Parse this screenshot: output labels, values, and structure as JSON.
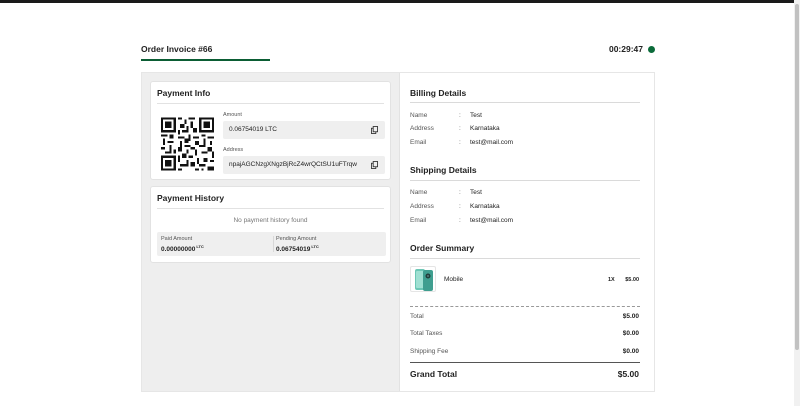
{
  "header": {
    "title": "Order Invoice #66",
    "timer": "00:29:47"
  },
  "payment_info": {
    "title": "Payment Info",
    "amount_label": "Amount",
    "amount_value": "0.06754019 LTC",
    "address_label": "Address",
    "address_value": "npajAGCNzgXNgzBjRcZ4wrQCtSU1uFTrqw"
  },
  "payment_history": {
    "title": "Payment History",
    "empty_message": "No payment history found",
    "paid_label": "Paid Amount",
    "paid_value": "0.00000000",
    "paid_unit": "LTC",
    "pending_label": "Pending Amount",
    "pending_value": "0.06754019",
    "pending_unit": "LTC"
  },
  "billing": {
    "title": "Billing Details",
    "rows": [
      {
        "key": "Name",
        "value": "Test"
      },
      {
        "key": "Address",
        "value": "Karnataka"
      },
      {
        "key": "Email",
        "value": "test@mail.com"
      }
    ]
  },
  "shipping": {
    "title": "Shipping Details",
    "rows": [
      {
        "key": "Name",
        "value": "Test"
      },
      {
        "key": "Address",
        "value": "Karnataka"
      },
      {
        "key": "Email",
        "value": "test@mail.com"
      }
    ]
  },
  "order_summary": {
    "title": "Order Summary",
    "items": [
      {
        "name": "Mobile",
        "qty": "1X",
        "price": "$5.00"
      }
    ],
    "total_label": "Total",
    "total_value": "$5.00",
    "taxes_label": "Total Taxes",
    "taxes_value": "$0.00",
    "shipping_label": "Shipping Fee",
    "shipping_value": "$0.00",
    "grand_label": "Grand Total",
    "grand_value": "$5.00"
  },
  "colors": {
    "accent": "#0b5d34",
    "status_dot": "#0b6b3a",
    "panel_bg": "#eeeeee"
  },
  "icons": [
    "copy-icon",
    "qr-code",
    "status-dot-icon"
  ]
}
